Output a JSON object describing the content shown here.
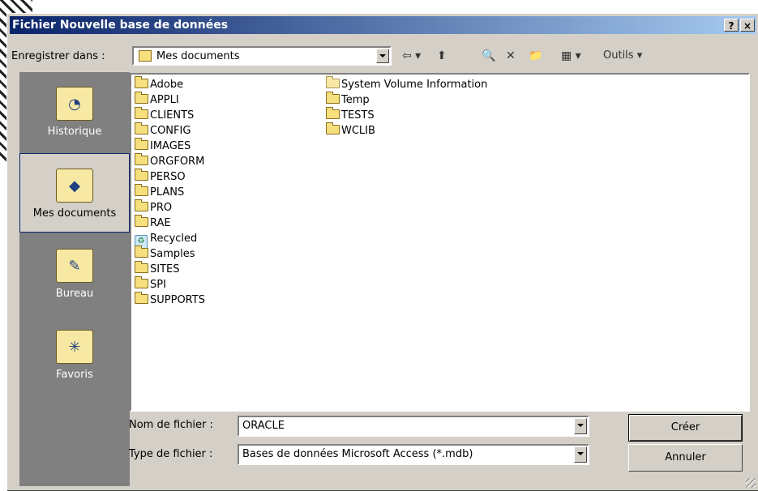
{
  "window": {
    "title": "Fichier Nouvelle base de données",
    "help_btn": "?",
    "close_btn": "×"
  },
  "toolbar": {
    "save_in_label": "Enregistrer dans :",
    "location": "Mes documents",
    "tools_label": "Outils ▾",
    "back_icon": "⇦ ▾",
    "up_icon": "⬆",
    "search_icon": "🔍",
    "delete_icon": "✕",
    "newfolder_icon": "📁",
    "views_icon": "▦ ▾"
  },
  "places": [
    {
      "label": "Historique",
      "icon": "history-icon",
      "glyph": "◔"
    },
    {
      "label": "Mes documents",
      "icon": "my-documents-icon",
      "glyph": "◆"
    },
    {
      "label": "Bureau",
      "icon": "desktop-icon",
      "glyph": "✎"
    },
    {
      "label": "Favoris",
      "icon": "favorites-icon",
      "glyph": "✳"
    }
  ],
  "files": {
    "col1": [
      "Adobe",
      "APPLI",
      "CLIENTS",
      "CONFIG",
      "IMAGES",
      "ORGFORM",
      "PERSO",
      "PLANS",
      "PRO",
      "RAE",
      "Recycled",
      "Samples",
      "SITES",
      "SPI",
      "SUPPORTS"
    ],
    "col2": [
      "System Volume Information",
      "Temp",
      "TESTS",
      "WCLIB"
    ]
  },
  "footer": {
    "filename_label": "Nom de fichier :",
    "filename_value": "ORACLE",
    "filetype_label": "Type de fichier :",
    "filetype_value": "Bases de données Microsoft Access (*.mdb)",
    "create_btn": "Créer",
    "cancel_btn": "Annuler"
  }
}
